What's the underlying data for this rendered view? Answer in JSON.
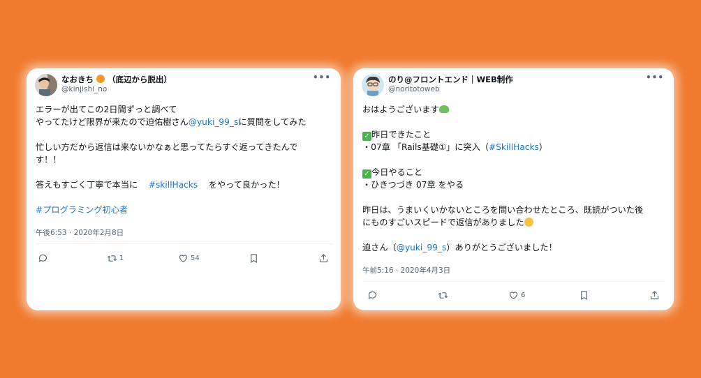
{
  "tweets": [
    {
      "name": "なおきち",
      "name_suffix": "（底辺から脱出）",
      "handle": "@kinjishi_no",
      "lines": {
        "l1": "エラーが出てこの2日間ずっと調べて",
        "l2a": "やってたけど限界が来たので迫佑樹さん",
        "l2_mention": "@yuki_99_s",
        "l2b": "に質問をしてみた",
        "l3": "忙しい方だから返信は来ないかなぁと思ってたらすぐ返ってきたんで",
        "l4": "す！！",
        "l5a": "答えもすごく丁寧で本当に",
        "l5_tag": "#skillHacks",
        "l5b": "をやって良かった！",
        "l6_tag": "#プログラミング初心者"
      },
      "timestamp": "午後6:53 · 2020年2月8日",
      "actions": {
        "retweets": "1",
        "likes": "54"
      }
    },
    {
      "name": "のり@フロントエンド｜WEB制作",
      "handle": "@noritotoweb",
      "lines": {
        "l1": "おはようございます",
        "l2": "昨日できたこと",
        "l3a": "・07章 「Rails基礎①」に突入（",
        "l3_tag": "#SkillHacks",
        "l3b": "）",
        "l4": "今日やること",
        "l5": "・ひきつづき 07章 をやる",
        "l6": "昨日は、うまいくいかないところを問い合わせたところ、既読がついた後",
        "l7": "にものすごいスピードで返信がありました",
        "l8a": "迫さん（",
        "l8_mention": "@yuki_99_s",
        "l8b": "）ありがとうございました！"
      },
      "timestamp": "午前5:16 · 2020年4月3日",
      "actions": {
        "likes": "6"
      }
    }
  ],
  "icons": {
    "more": "more-horizontal-icon",
    "reply": "reply-icon",
    "retweet": "retweet-icon",
    "like": "heart-icon",
    "bookmark": "bookmark-icon",
    "share": "share-icon"
  },
  "colors": {
    "background": "#f07a2d",
    "link": "#1d73c4",
    "muted": "#536471"
  }
}
